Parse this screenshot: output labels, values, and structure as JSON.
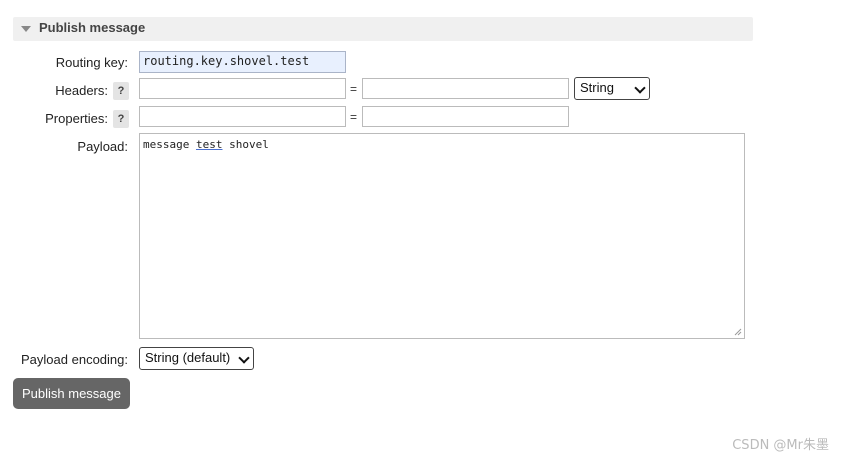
{
  "section": {
    "title": "Publish message"
  },
  "routing_key": {
    "label": "Routing key:",
    "value": "routing.key.shovel.test"
  },
  "headers": {
    "label": "Headers:",
    "help": "?",
    "key_value": "",
    "equals": "=",
    "value_value": "",
    "type_selected": "String"
  },
  "properties": {
    "label": "Properties:",
    "help": "?",
    "key_value": "",
    "equals": "=",
    "value_value": ""
  },
  "payload": {
    "label": "Payload:",
    "text_before": "message ",
    "text_spell": "test",
    "text_after": " shovel"
  },
  "encoding": {
    "label": "Payload encoding:",
    "selected": "String (default)"
  },
  "publish_button": {
    "label": "Publish message"
  },
  "watermark": {
    "text": "CSDN @Mr朱墨"
  },
  "colors": {
    "button_bg": "#666666",
    "filled_input_bg": "#e8f0fe",
    "header_bg": "#f0f0f0"
  }
}
